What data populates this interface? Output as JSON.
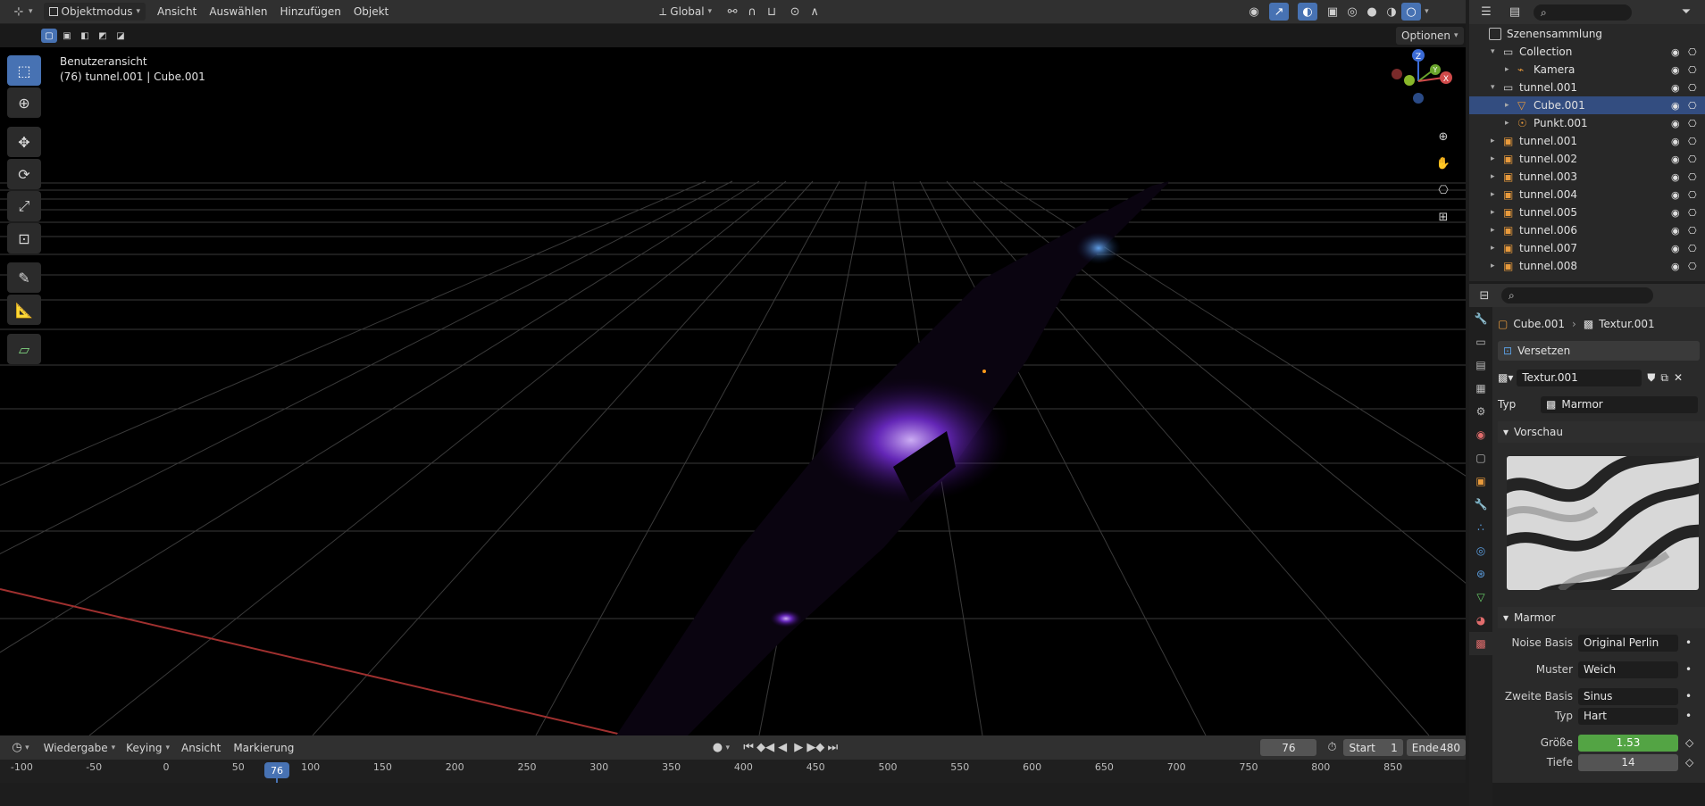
{
  "header": {
    "mode": "Objektmodus",
    "menus": [
      "Ansicht",
      "Auswählen",
      "Hinzufügen",
      "Objekt"
    ],
    "transform_orientation": "Global",
    "options_label": "Optionen"
  },
  "viewport": {
    "view_name": "Benutzeransicht",
    "object_info": "(76) tunnel.001 | Cube.001",
    "gizmo": {
      "z": "Z",
      "y": "Y",
      "x": "X"
    }
  },
  "outliner": {
    "root": "Szenensammlung",
    "rows": [
      {
        "label": "Collection",
        "indent": 1,
        "type": "collection"
      },
      {
        "label": "Kamera",
        "indent": 2,
        "type": "camera"
      },
      {
        "label": "tunnel.001",
        "indent": 1,
        "type": "collection"
      },
      {
        "label": "Cube.001",
        "indent": 2,
        "type": "mesh"
      },
      {
        "label": "Punkt.001",
        "indent": 2,
        "type": "light"
      },
      {
        "label": "tunnel.001",
        "indent": 1,
        "type": "object"
      },
      {
        "label": "tunnel.002",
        "indent": 1,
        "type": "object"
      },
      {
        "label": "tunnel.003",
        "indent": 1,
        "type": "object"
      },
      {
        "label": "tunnel.004",
        "indent": 1,
        "type": "object"
      },
      {
        "label": "tunnel.005",
        "indent": 1,
        "type": "object"
      },
      {
        "label": "tunnel.006",
        "indent": 1,
        "type": "object"
      },
      {
        "label": "tunnel.007",
        "indent": 1,
        "type": "object"
      },
      {
        "label": "tunnel.008",
        "indent": 1,
        "type": "object"
      }
    ]
  },
  "properties": {
    "breadcrumb_object": "Cube.001",
    "breadcrumb_texture": "Textur.001",
    "modifier": "Versetzen",
    "texture_name": "Textur.001",
    "type_label": "Typ",
    "type_value": "Marmor",
    "preview_panel": "Vorschau",
    "marble_panel": "Marmor",
    "noise_basis_label": "Noise Basis",
    "noise_basis_value": "Original Perlin",
    "pattern_label": "Muster",
    "pattern_value": "Weich",
    "second_basis_label": "Zweite Basis",
    "second_basis_value": "Sinus",
    "type2_label": "Typ",
    "type2_value": "Hart",
    "size_label": "Größe",
    "size_value": "1.53",
    "depth_label": "Tiefe",
    "depth_value": "14"
  },
  "timeline": {
    "menus": [
      "Wiedergabe",
      "Keying",
      "Ansicht",
      "Markierung"
    ],
    "current_frame": "76",
    "start_label": "Start",
    "start_value": "1",
    "end_label": "Ende",
    "end_value": "480",
    "ruler_ticks": [
      "-100",
      "-50",
      "0",
      "50",
      "100",
      "150",
      "200",
      "250",
      "300",
      "350",
      "400",
      "450",
      "500",
      "550",
      "600",
      "650",
      "700",
      "750",
      "800",
      "850"
    ],
    "playhead": "76"
  }
}
